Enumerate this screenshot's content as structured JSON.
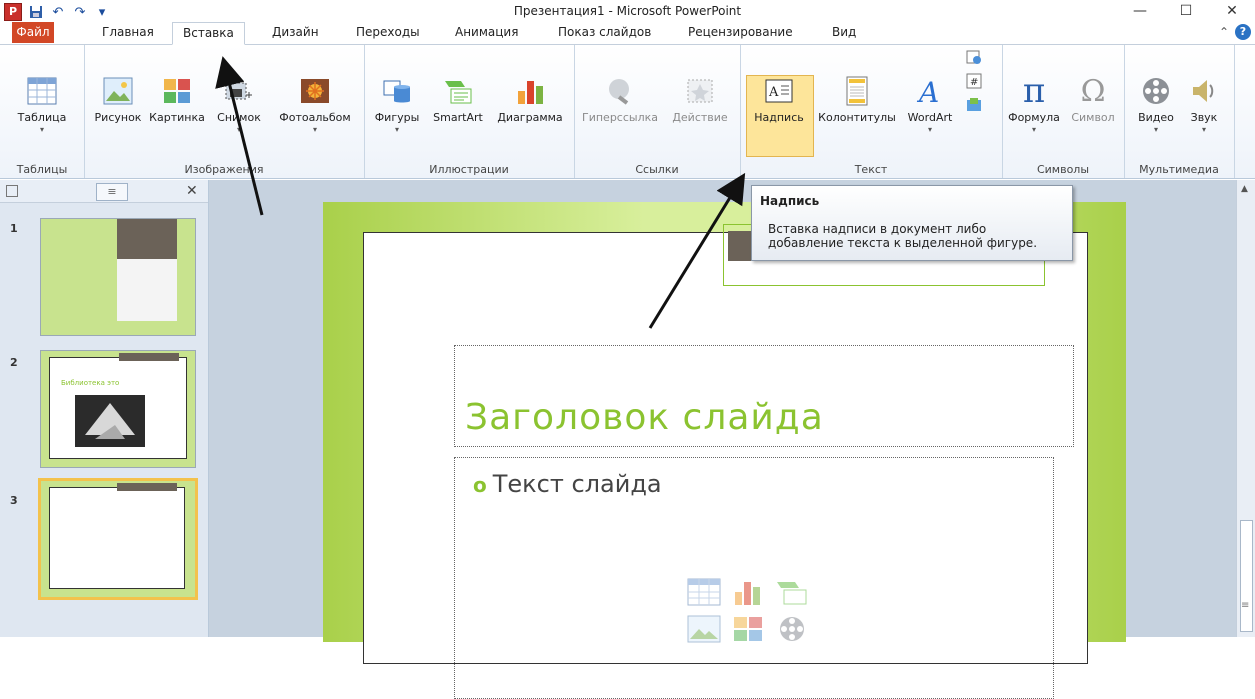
{
  "window": {
    "title": "Презентация1 - Microsoft PowerPoint",
    "logo": "P",
    "controls": [
      "—",
      "☐",
      "✕"
    ]
  },
  "tabs": [
    {
      "label": "Файл",
      "active": false,
      "file": true
    },
    {
      "label": "Главная",
      "active": false
    },
    {
      "label": "Вставка",
      "active": true
    },
    {
      "label": "Дизайн",
      "active": false
    },
    {
      "label": "Переходы",
      "active": false
    },
    {
      "label": "Анимация",
      "active": false
    },
    {
      "label": "Показ слайдов",
      "active": false
    },
    {
      "label": "Рецензирование",
      "active": false
    },
    {
      "label": "Вид",
      "active": false
    }
  ],
  "help": {
    "icon": "?"
  },
  "ribbon": {
    "groups": {
      "tables": {
        "name": "Таблицы",
        "buttons": [
          "Таблица"
        ]
      },
      "images": {
        "name": "Изображения",
        "buttons": [
          "Рисунок",
          "Картинка",
          "Снимок",
          "Фотоальбом"
        ]
      },
      "illustrations": {
        "name": "Иллюстрации",
        "buttons": [
          "Фигуры",
          "SmartArt",
          "Диаграмма"
        ]
      },
      "links": {
        "name": "Ссылки",
        "buttons": [
          "Гиперссылка",
          "Действие"
        ]
      },
      "text": {
        "name": "Текст",
        "buttons": [
          "Надпись",
          "Колонтитулы",
          "WordArt"
        ]
      },
      "symbols": {
        "name": "Символы",
        "buttons": [
          "Формула",
          "Символ"
        ]
      },
      "media": {
        "name": "Мультимедиа",
        "buttons": [
          "Видео",
          "Звук"
        ]
      }
    }
  },
  "tooltip": {
    "title": "Надпись",
    "text": "Вставка надписи в документ либо добавление текста к выделенной фигуре."
  },
  "slides_pane": {
    "close": "✕",
    "slides": [
      {
        "number": "1"
      },
      {
        "number": "2",
        "text": "Библиотека это"
      },
      {
        "number": "3"
      }
    ]
  },
  "slide": {
    "title_placeholder": "Заголовок слайда",
    "body_placeholder": "Текст слайда",
    "bullet": "o"
  },
  "colors": {
    "accent_green": "#8bc330",
    "file_tab": "#d24726",
    "highlight": "#fde59a"
  }
}
